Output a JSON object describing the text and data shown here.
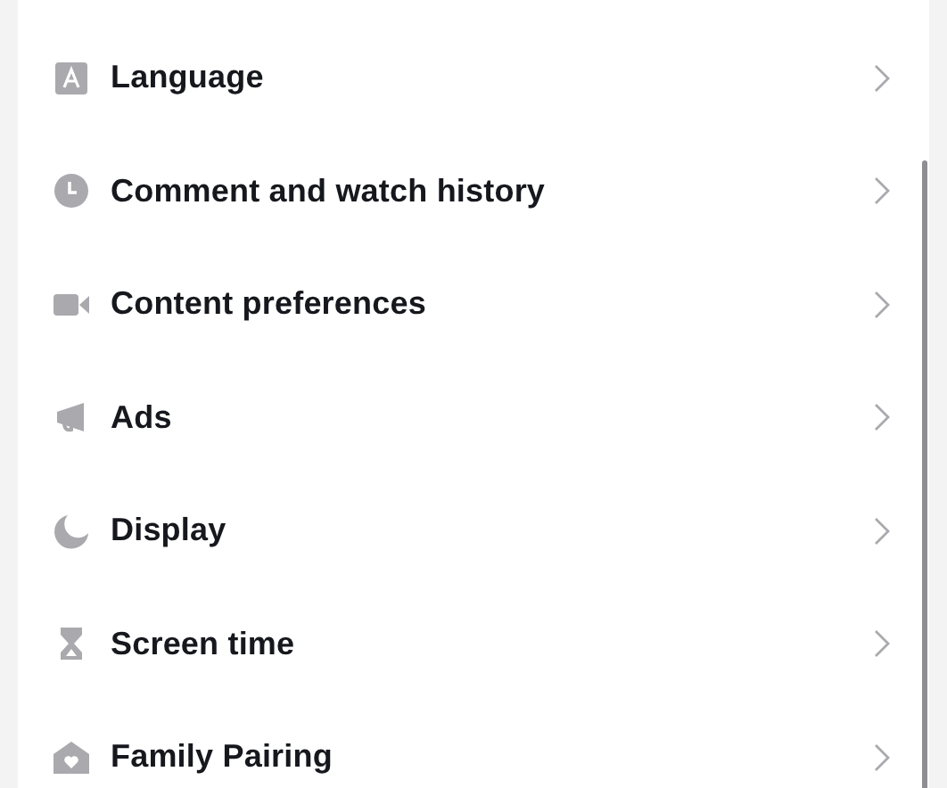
{
  "settings_items": [
    {
      "label": "Language"
    },
    {
      "label": "Comment and watch history"
    },
    {
      "label": "Content preferences"
    },
    {
      "label": "Ads"
    },
    {
      "label": "Display"
    },
    {
      "label": "Screen time"
    },
    {
      "label": "Family Pairing"
    }
  ]
}
